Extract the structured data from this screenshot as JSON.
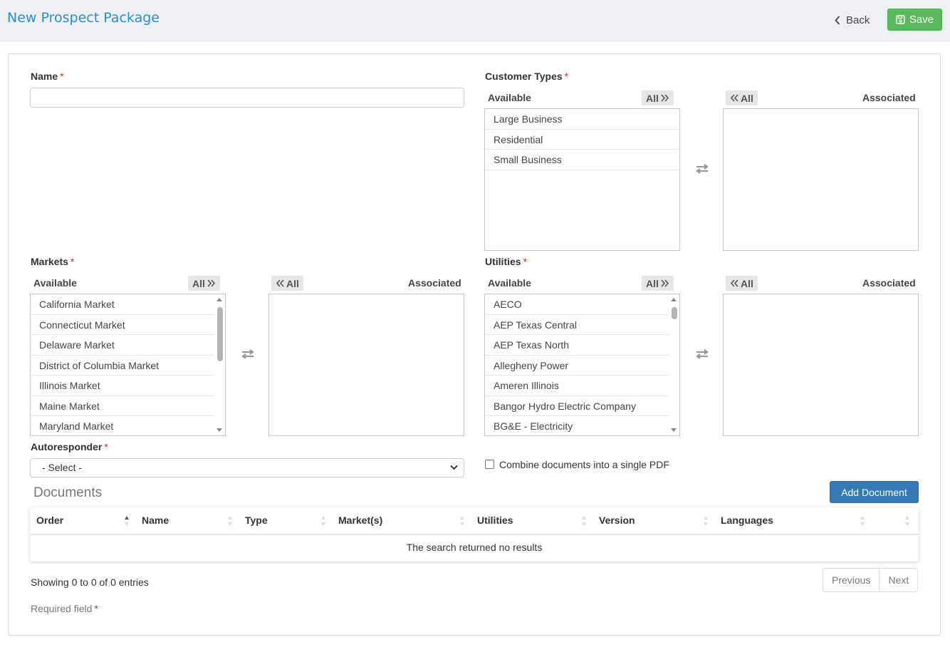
{
  "header": {
    "title": "New Prospect Package",
    "back_label": "Back",
    "save_label": "Save"
  },
  "form": {
    "name_label": "Name",
    "required_mark": "*",
    "customer_types": {
      "label": "Customer Types",
      "available_label": "Available",
      "associated_label": "Associated",
      "all_label": "All",
      "available_items": [
        "Large Business",
        "Residential",
        "Small Business"
      ],
      "associated_items": []
    },
    "markets": {
      "label": "Markets",
      "available_label": "Available",
      "associated_label": "Associated",
      "all_label": "All",
      "available_items": [
        "California Market",
        "Connecticut Market",
        "Delaware Market",
        "District of Columbia Market",
        "Illinois Market",
        "Maine Market",
        "Maryland Market"
      ],
      "associated_items": []
    },
    "utilities": {
      "label": "Utilities",
      "available_label": "Available",
      "associated_label": "Associated",
      "all_label": "All",
      "available_items": [
        "AECO",
        "AEP Texas Central",
        "AEP Texas North",
        "Allegheny Power",
        "Ameren Illinois",
        "Bangor Hydro Electric Company",
        "BG&E - Electricity"
      ],
      "associated_items": []
    },
    "autoresponder": {
      "label": "Autoresponder",
      "selected": "- Select -"
    },
    "combine_pdf_label": "Combine documents into a single PDF"
  },
  "documents": {
    "title": "Documents",
    "add_label": "Add Document",
    "columns": [
      "Order",
      "Name",
      "Type",
      "Market(s)",
      "Utilities",
      "Version",
      "Languages",
      ""
    ],
    "empty_message": "The search returned no results",
    "info": "Showing 0 to 0 of 0 entries",
    "prev_label": "Previous",
    "next_label": "Next"
  },
  "footer": {
    "required_note": "Required field"
  },
  "colors": {
    "title_blue": "#2a8bd6",
    "save_green": "#5cb85c",
    "add_blue": "#337ab7",
    "required_red": "#c9302c"
  }
}
